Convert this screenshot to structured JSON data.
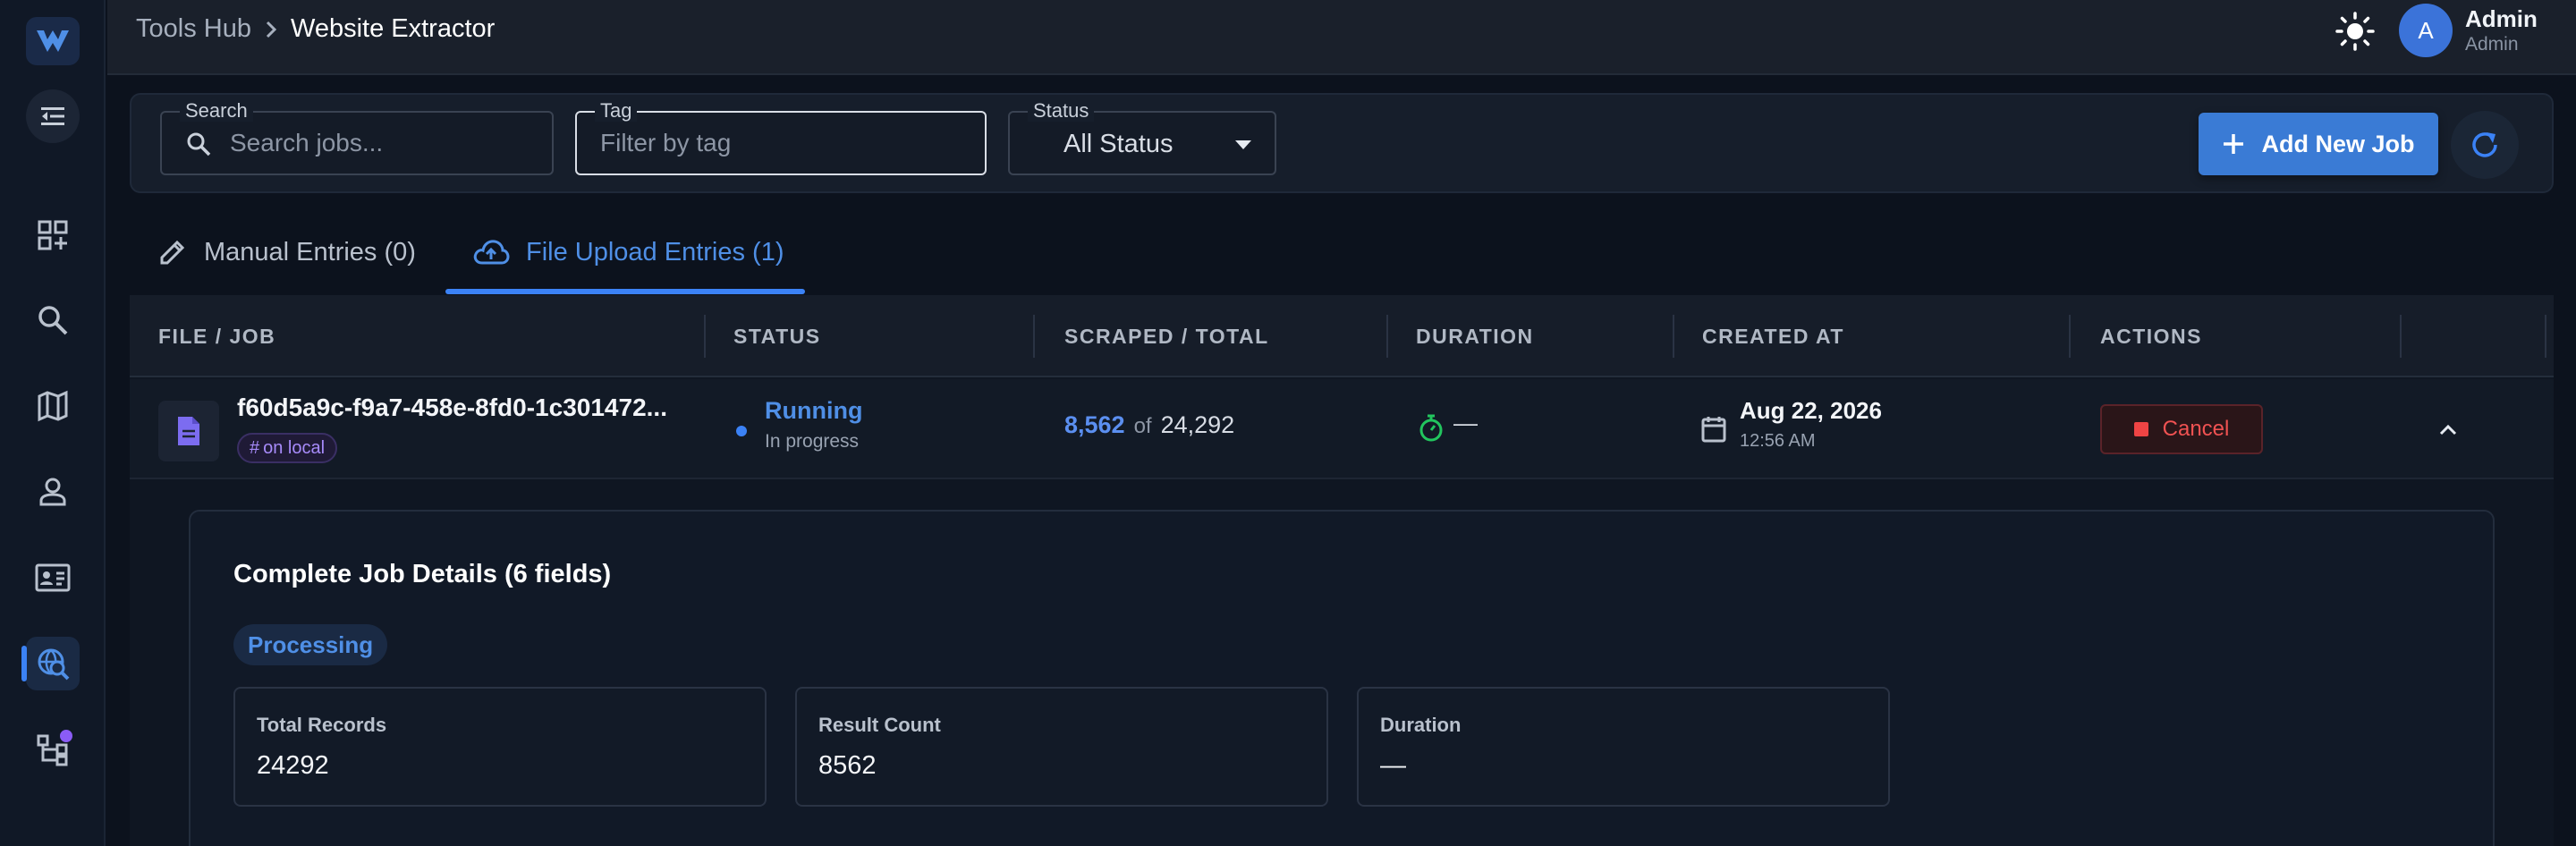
{
  "breadcrumb": {
    "root": "Tools Hub",
    "current": "Website Extractor"
  },
  "user": {
    "initial": "A",
    "name": "Admin",
    "role": "Admin"
  },
  "filters": {
    "search": {
      "label": "Search",
      "placeholder": "Search jobs..."
    },
    "tag": {
      "label": "Tag",
      "placeholder": "Filter by tag"
    },
    "status": {
      "label": "Status",
      "value": "All Status"
    }
  },
  "actions": {
    "add_job": "Add New Job"
  },
  "tabs": [
    {
      "label": "Manual Entries (0)"
    },
    {
      "label": "File Upload Entries (1)"
    }
  ],
  "table": {
    "columns": [
      "FILE / JOB",
      "STATUS",
      "SCRAPED / TOTAL",
      "DURATION",
      "CREATED AT",
      "ACTIONS"
    ],
    "rows": [
      {
        "name": "f60d5a9c-f9a7-458e-8fd0-1c301472...",
        "tag": "on local",
        "tag_prefix": "#",
        "status": "Running",
        "status_sub": "In progress",
        "scraped": "8,562",
        "of": "of",
        "total": "24,292",
        "duration": "—",
        "created_date": "Aug 22, 2026",
        "created_time": "12:56 AM",
        "action": "Cancel"
      }
    ]
  },
  "details": {
    "title": "Complete Job Details (6 fields)",
    "chip": "Processing",
    "cards": [
      {
        "label": "Total Records",
        "value": "24292"
      },
      {
        "label": "Result Count",
        "value": "8562"
      },
      {
        "label": "Duration",
        "value": "—"
      }
    ]
  },
  "colors": {
    "accent": "#3b82f6",
    "danger": "#ef4444",
    "tag": "#a78bfa",
    "success": "#22c55e"
  }
}
